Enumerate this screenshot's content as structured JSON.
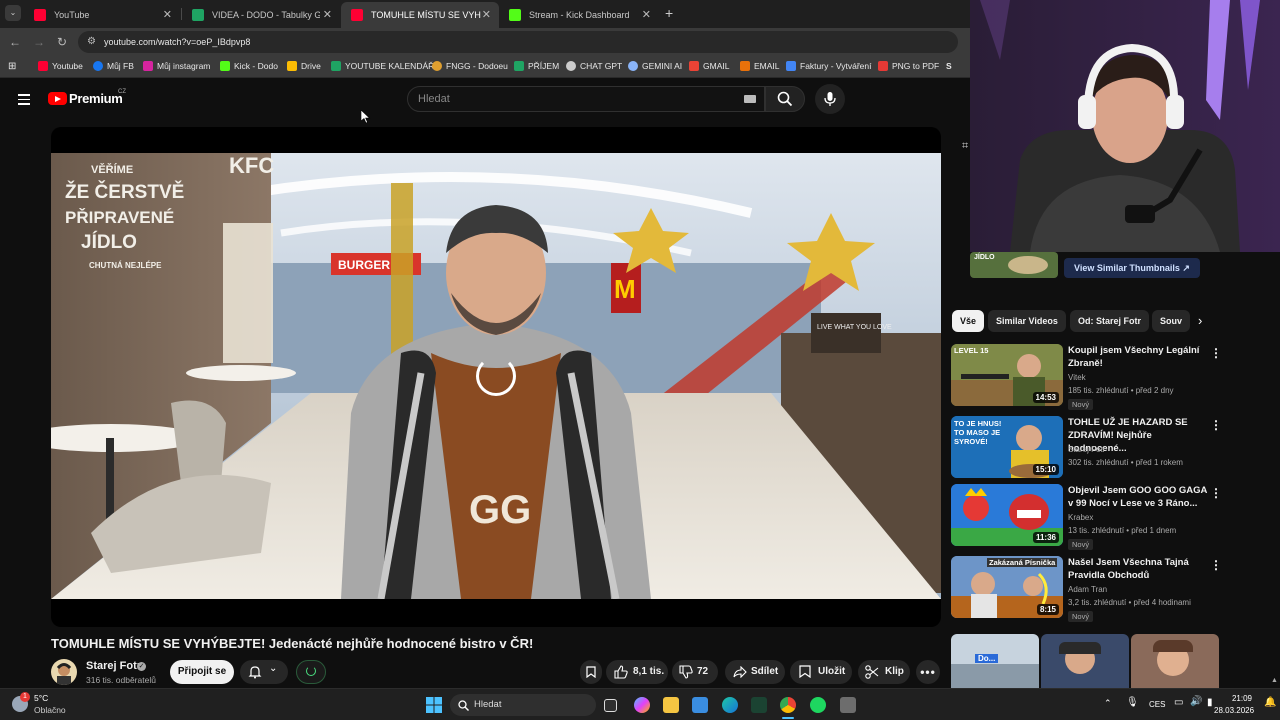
{
  "tabs": [
    {
      "label": "YouTube",
      "favicon_color": "#ff0033"
    },
    {
      "label": "VIDEA - DODO - Tabulky Googl",
      "favicon_color": "#1fa463"
    },
    {
      "label": "TOMUHLE MÍSTU SE VYHÝBEJTE",
      "favicon_color": "#ff0033"
    },
    {
      "label": "Stream - Kick Dashboard",
      "favicon_color": "#53fc18"
    }
  ],
  "address_bar": {
    "url": "youtube.com/watch?v=oeP_IBdpvp8"
  },
  "bookmarks": [
    {
      "label": "Youtube",
      "color": "#ff0033"
    },
    {
      "label": "Můj FB",
      "color": "#1877f2"
    },
    {
      "label": "Můj instagram",
      "color": "#d6249f"
    },
    {
      "label": "Kick - Dodo",
      "color": "#53fc18"
    },
    {
      "label": "Drive",
      "color": "#fbbc04"
    },
    {
      "label": "YOUTUBE KALENDÁŘ",
      "color": "#1fa463"
    },
    {
      "label": "FNGG - Dodoeu",
      "color": "#e0a030"
    },
    {
      "label": "PŘÍJEM",
      "color": "#1fa463"
    },
    {
      "label": "CHAT GPT",
      "color": "#cccccc"
    },
    {
      "label": "GEMINI AI",
      "color": "#8ab4f8"
    },
    {
      "label": "GMAIL",
      "color": "#ea4335"
    },
    {
      "label": "EMAIL",
      "color": "#e8710a"
    },
    {
      "label": "Faktury - Vytváření",
      "color": "#4285f4"
    },
    {
      "label": "PNG to PDF",
      "color": "#e53935"
    },
    {
      "label": "S",
      "color": "#ffffff"
    }
  ],
  "yt_header": {
    "brand": "Premium",
    "country": "CZ",
    "search_placeholder": "Hledat"
  },
  "video": {
    "title": "TOMUHLE MÍSTU SE VYHÝBEJTE! Jedenácté nejhůře hodnocené bistro v ČR!",
    "channel": "Starej Fotr",
    "subscribers": "316 tis. odběratelů",
    "join_label": "Připojit se",
    "likes": "8,1 tis.",
    "dislikes": "72",
    "share_label": "Sdílet",
    "save_label": "Uložit",
    "clip_label": "Klip"
  },
  "scene_text": {
    "wall_lines": [
      "VĚŘÍME",
      "ŽE ČERSTVĚ",
      "PŘIPRAVENÉ",
      "JÍDLO",
      "CHUTNÁ NEJLÉPE"
    ],
    "burger_sign": "BURGER",
    "kfc_sign": "KFC",
    "shirt_text": "GG",
    "live_sign": "LIVE WHAT YOU LOVE"
  },
  "right_panel": {
    "similar_thumbnails_label": "View Similar Thumbnails",
    "thumb_label": "JÍDLO",
    "chips": [
      "Vše",
      "Similar Videos",
      "Od: Starej Fotr",
      "Souv"
    ],
    "recommendations": [
      {
        "title": "Koupil jsem Všechny Legální Zbraně!",
        "channel": "Vitek",
        "meta": "185 tis. zhlédnutí • před 2 dny",
        "badge": "Nový",
        "duration": "14:53",
        "thumb_label": "LEVEL 15",
        "thumb_color": "#6d7a3a"
      },
      {
        "title": "TOHLE UŽ JE HAZARD SE ZDRAVÍM! Nejhůře hodnocené...",
        "channel": "Starej Fotr",
        "meta": "302 tis. zhlédnutí • před 1 rokem",
        "badge": "",
        "duration": "15:10",
        "thumb_label": "TO JE HNUS! TO MASO JE SYROVÉ!",
        "thumb_color": "#1d6fb8"
      },
      {
        "title": "Objevil Jsem GOO GOO GAGA v 99 Nocí v Lese ve 3 Ráno...",
        "channel": "Krabex",
        "meta": "13 tis. zhlédnutí • před 1 dnem",
        "badge": "Nový",
        "duration": "11:36",
        "thumb_label": "",
        "thumb_color": "#2a7ad8"
      },
      {
        "title": "Našel Jsem Všechna Tajná Pravidla Obchodů",
        "channel": "Adam Tran",
        "meta": "3,2 tis. zhlédnutí • před 4 hodinami",
        "badge": "Nový",
        "duration": "8:15",
        "thumb_label": "Zakázaná Písnička",
        "thumb_color": "#5a86c0"
      }
    ],
    "shorts_label": "Do..."
  },
  "taskbar": {
    "weather_temp": "5°C",
    "weather_desc": "Oblačno",
    "weather_badge": "1",
    "search_placeholder": "Hledat",
    "language": "CES",
    "time": "21:09",
    "date": "28.03.2026"
  }
}
